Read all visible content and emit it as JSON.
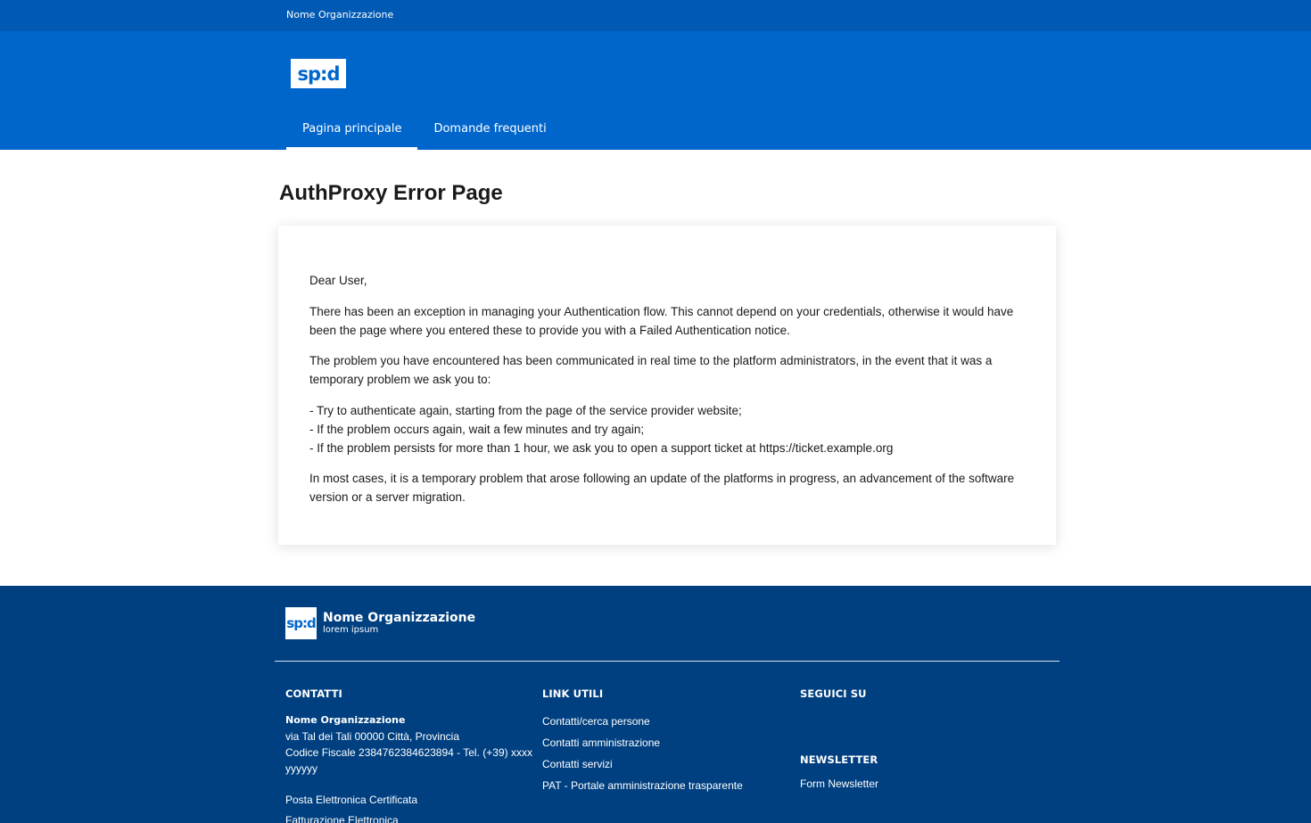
{
  "slim_header": {
    "org_name": "Nome Organizzazione"
  },
  "header": {
    "logo_text": "sp:d",
    "nav": [
      {
        "label": "Pagina principale",
        "active": true
      },
      {
        "label": "Domande frequenti",
        "active": false
      }
    ]
  },
  "main": {
    "title": "AuthProxy Error Page",
    "greeting": "Dear User,",
    "paragraph1": "There has been an exception in managing your Authentication flow. This cannot depend on your credentials, otherwise it would have been the page where you entered these to provide you with a Failed Authentication notice.",
    "paragraph2": "The problem you have encountered has been communicated in real time to the platform administrators, in the event that it was a temporary problem we ask you to:",
    "steps": [
      "- Try to authenticate again, starting from the page of the service provider website;",
      "- If the problem occurs again, wait a few minutes and try again;",
      "- If the problem persists for more than 1 hour, we ask you to open a support ticket at https://ticket.example.org"
    ],
    "paragraph3": "In most cases, it is a temporary problem that arose following an update of the platforms in progress, an advancement of the software version or a server migration."
  },
  "footer": {
    "logo_text": "sp:d",
    "org_name": "Nome Organizzazione",
    "org_sub": "lorem ipsum",
    "contatti": {
      "title": "CONTATTI",
      "name": "Nome Organizzazione",
      "address": "via Tal dei Tali 00000 Città, Provincia",
      "fiscal": "Codice Fiscale 2384762384623894 - Tel. (+39) xxxx yyyyyy",
      "pec": "Posta Elettronica Certificata",
      "invoice": "Fatturazione Elettronica"
    },
    "link_utili": {
      "title": "LINK UTILI",
      "items": [
        "Contatti/cerca persone",
        "Contatti amministrazione",
        "Contatti servizi",
        "PAT - Portale amministrazione trasparente"
      ]
    },
    "seguici": {
      "title": "SEGUICI SU"
    },
    "newsletter": {
      "title": "NEWSLETTER",
      "link": "Form Newsletter"
    }
  }
}
